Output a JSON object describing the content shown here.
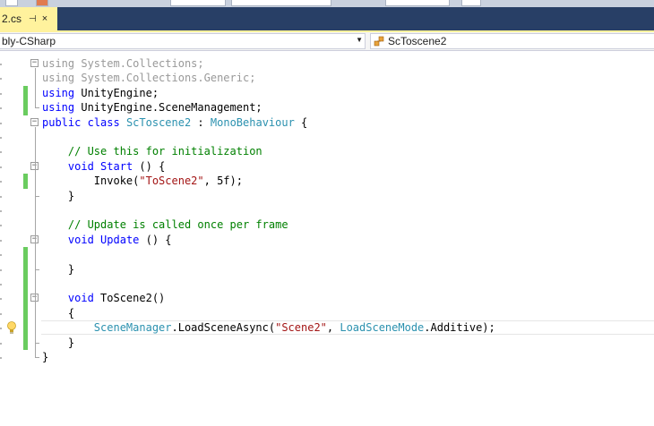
{
  "tab": {
    "filename": "2.cs",
    "pin": "⊣",
    "close": "×"
  },
  "navbar": {
    "project": "bly-CSharp",
    "class": "ScToscene2"
  },
  "icons": {
    "pin": "pin-icon",
    "close": "close-icon",
    "dropdown": "chevron-down-icon",
    "class": "class-icon",
    "bulb": "lightbulb-icon"
  },
  "colors": {
    "keyword": "#0000ff",
    "type": "#2b91af",
    "comment": "#008000",
    "string": "#a31515",
    "change": "#6acc5f",
    "tab": "#fff29d",
    "tabbar": "#283f66"
  },
  "code_lines": [
    [
      [
        "using System.Collections;",
        "gr"
      ]
    ],
    [
      [
        "using System.Collections.Generic;",
        "gr"
      ]
    ],
    [
      [
        "using",
        "kw"
      ],
      [
        " UnityEngine;",
        ""
      ]
    ],
    [
      [
        "using",
        "kw"
      ],
      [
        " UnityEngine.SceneManagement;",
        ""
      ]
    ],
    [
      [
        "public",
        "kw"
      ],
      [
        " ",
        ""
      ],
      [
        "class",
        "kw"
      ],
      [
        " ",
        ""
      ],
      [
        "ScToscene2",
        "ty"
      ],
      [
        " : ",
        ""
      ],
      [
        "MonoBehaviour",
        "ty"
      ],
      [
        " {",
        ""
      ]
    ],
    [],
    [
      [
        "    ",
        ""
      ],
      [
        "// Use this for initialization",
        "cm"
      ]
    ],
    [
      [
        "    ",
        ""
      ],
      [
        "void",
        "kw"
      ],
      [
        " ",
        ""
      ],
      [
        "Start",
        "kw"
      ],
      [
        " () {",
        ""
      ]
    ],
    [
      [
        "        Invoke(",
        ""
      ],
      [
        "\"ToScene2\"",
        "st"
      ],
      [
        ", 5f);",
        ""
      ]
    ],
    [
      [
        "    }",
        ""
      ]
    ],
    [],
    [
      [
        "    ",
        ""
      ],
      [
        "// Update is called once per frame",
        "cm"
      ]
    ],
    [
      [
        "    ",
        ""
      ],
      [
        "void",
        "kw"
      ],
      [
        " ",
        ""
      ],
      [
        "Update",
        "kw"
      ],
      [
        " () {",
        ""
      ]
    ],
    [],
    [
      [
        "    }",
        ""
      ]
    ],
    [],
    [
      [
        "    ",
        ""
      ],
      [
        "void",
        "kw"
      ],
      [
        " ToScene2()",
        ""
      ]
    ],
    [
      [
        "    {",
        ""
      ]
    ],
    [
      [
        "        ",
        ""
      ],
      [
        "SceneManager",
        "ty"
      ],
      [
        ".LoadSceneAsync(",
        ""
      ],
      [
        "\"Scene2\"",
        "st"
      ],
      [
        ", ",
        ""
      ],
      [
        "LoadSceneMode",
        "ty"
      ],
      [
        ".Additive);",
        ""
      ]
    ],
    [
      [
        "    }",
        ""
      ]
    ],
    [
      [
        "}",
        ""
      ]
    ]
  ]
}
